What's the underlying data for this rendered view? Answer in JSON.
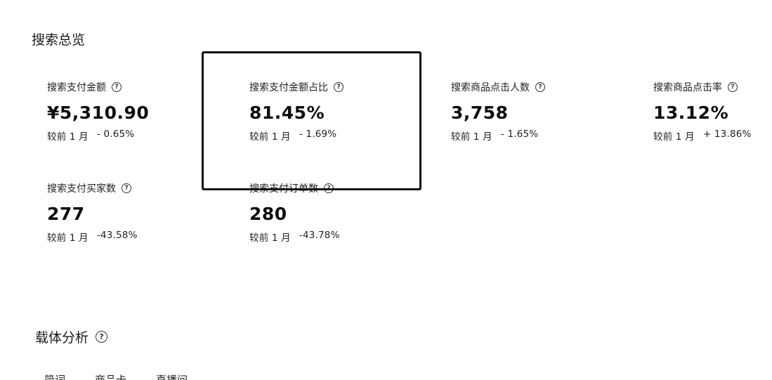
{
  "overview": {
    "title": "搜索总览"
  },
  "metrics": [
    {
      "label": "搜索支付金额",
      "value": "¥5,310.90",
      "compare_period": "较前 1 月",
      "change": "- 0.65%"
    },
    {
      "label": "搜索支付金额占比",
      "value": "81.45%",
      "compare_period": "较前 1 月",
      "change": "- 1.69%"
    },
    {
      "label": "搜索商品点击人数",
      "value": "3,758",
      "compare_period": "较前 1 月",
      "change": "- 1.65%"
    },
    {
      "label": "搜索商品点击率",
      "value": "13.12%",
      "compare_period": "较前 1 月",
      "change": "+ 13.86%"
    },
    {
      "label": "搜索支付买家数",
      "value": "277",
      "compare_period": "较前 1 月",
      "change": "-43.58%"
    },
    {
      "label": "搜索支付订单数",
      "value": "280",
      "compare_period": "较前 1 月",
      "change": "-43.78%"
    }
  ],
  "carrier": {
    "title": "载体分析"
  },
  "tabs": [
    "简词",
    "商品卡",
    "直播间"
  ],
  "icons": {
    "help": "question-circle-icon"
  },
  "colors": {
    "text": "#111111",
    "highlight_border": "#111111",
    "background": "#ffffff"
  }
}
